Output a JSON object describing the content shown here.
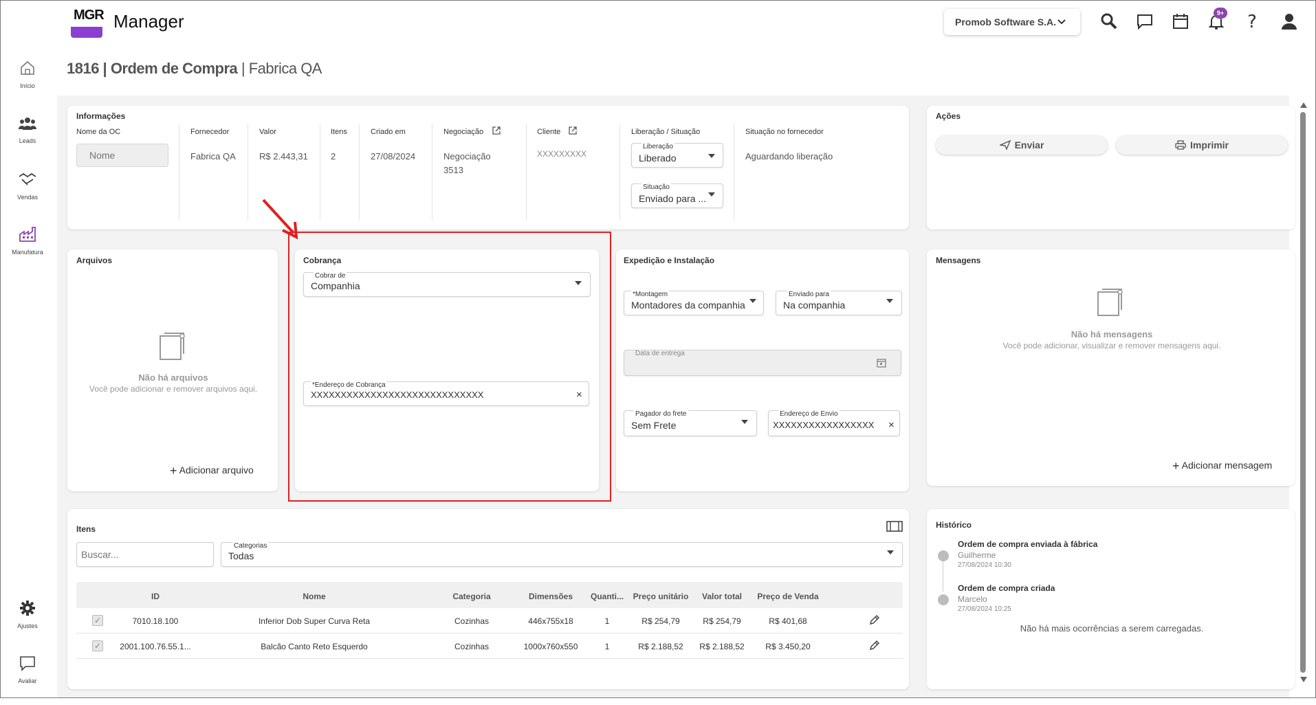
{
  "app": {
    "logo_text": "MGR",
    "title": "Manager"
  },
  "header": {
    "company": "Promob Software S.A.",
    "notifications_badge": "9+"
  },
  "sidebar": {
    "items": [
      {
        "label": "Início",
        "icon": "home-icon"
      },
      {
        "label": "Leads",
        "icon": "people-icon"
      },
      {
        "label": "Vendas",
        "icon": "handshake-icon"
      },
      {
        "label": "Manufatura",
        "icon": "factory-icon"
      },
      {
        "label": "Ajustes",
        "icon": "gear-icon"
      },
      {
        "label": "Avaliar",
        "icon": "chat-icon"
      }
    ]
  },
  "page": {
    "title_main": "1816 | Ordem de Compra",
    "title_sub": "| Fabrica QA"
  },
  "info": {
    "title": "Informações",
    "name_label": "Nome da OC",
    "name_placeholder": "Nome",
    "supplier_label": "Fornecedor",
    "supplier_value": "Fabrica QA",
    "value_label": "Valor",
    "value_value": "R$ 2.443,31",
    "items_label": "Itens",
    "items_value": "2",
    "created_label": "Criado em",
    "created_value": "27/08/2024",
    "negotiation_label": "Negociação",
    "negotiation_value": "Negociação 3513",
    "client_label": "Cliente",
    "client_value": "XXXXXXXXX",
    "release_group_label": "Liberação / Situação",
    "release_label": "Liberação",
    "release_value": "Liberado",
    "situation_label": "Situação",
    "situation_value": "Enviado para ...",
    "supplier_status_label": "Situação no fornecedor",
    "supplier_status_value": "Aguardando liberação"
  },
  "actions": {
    "title": "Ações",
    "send_label": "Enviar",
    "print_label": "Imprimir"
  },
  "files": {
    "title": "Arquivos",
    "empty_title": "Não há arquivos",
    "empty_sub": "Você pode adicionar e remover arquivos aqui.",
    "add_label": "Adicionar arquivo"
  },
  "billing": {
    "title": "Cobrança",
    "charge_from_label": "Cobrar de",
    "charge_from_value": "Companhia",
    "address_label": "*Endereço de Cobrança",
    "address_value": "XXXXXXXXXXXXXXXXXXXXXXXXXXXXX"
  },
  "shipping": {
    "title": "Expedição e Instalação",
    "assembly_label": "*Montagem",
    "assembly_value": "Montadores da companhia",
    "sent_to_label": "Enviado para",
    "sent_to_value": "Na companhia",
    "delivery_label": "Data de entrega",
    "freight_payer_label": "Pagador do frete",
    "freight_payer_value": "Sem Frete",
    "ship_address_label": "Endereço de Envio",
    "ship_address_value": "XXXXXXXXXXXXXXXXX"
  },
  "messages": {
    "title": "Mensagens",
    "empty_title": "Não há mensagens",
    "empty_sub": "Você pode adicionar, visualizar e remover mensagens aqui.",
    "add_label": "Adicionar mensagem"
  },
  "items": {
    "title": "Itens",
    "search_placeholder": "Buscar...",
    "categories_label": "Categorias",
    "categories_value": "Todas",
    "columns": [
      "ID",
      "Nome",
      "Categoria",
      "Dimensões",
      "Quanti...",
      "Preço unitário",
      "Valor total",
      "Preço de Venda"
    ],
    "rows": [
      {
        "id": "7010.18.100",
        "name": "Inferior Dob Super Curva Reta",
        "category": "Cozinhas",
        "dimensions": "446x755x18",
        "qty": "1",
        "unit_price": "R$ 254,79",
        "total": "R$ 254,79",
        "sale_price": "R$ 401,68"
      },
      {
        "id": "2001.100.76.55.1...",
        "name": "Balcão Canto Reto Esquerdo",
        "category": "Cozinhas",
        "dimensions": "1000x760x550",
        "qty": "1",
        "unit_price": "R$ 2.188,52",
        "total": "R$ 2.188,52",
        "sale_price": "R$ 3.450,20"
      }
    ]
  },
  "history": {
    "title": "Histórico",
    "events": [
      {
        "title": "Ordem de compra enviada à fábrica",
        "user": "Guilherme",
        "time": "27/08/2024 10:30"
      },
      {
        "title": "Ordem de compra criada",
        "user": "Marcelo",
        "time": "27/08/2024 10:25"
      }
    ],
    "footer": "Não há mais ocorrências a serem carregadas."
  },
  "colors": {
    "accent": "#8e44ad",
    "highlight": "#e02020",
    "logo_purple": "#8a3fd1"
  }
}
